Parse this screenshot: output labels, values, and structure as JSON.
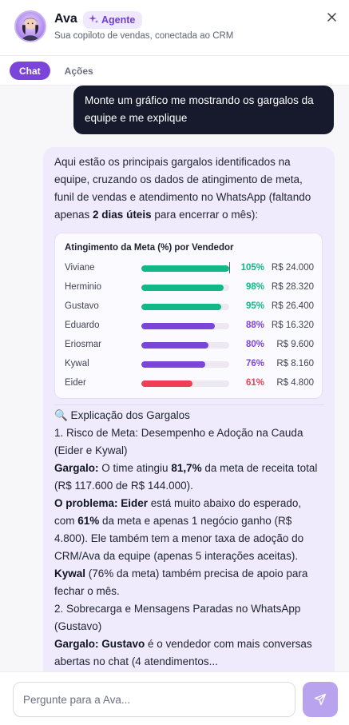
{
  "header": {
    "name": "Ava",
    "badge": "Agente",
    "subtitle": "Sua copiloto de vendas, conectada ao CRM"
  },
  "tabs": [
    {
      "label": "Chat",
      "active": true
    },
    {
      "label": "Ações",
      "active": false
    }
  ],
  "user_message": "Monte um gráfico me mostrando os gargalos da equipe e me explique",
  "bot": {
    "intro_before": "Aqui estão os principais gargalos identificados na equipe, cruzando os dados de atingimento de meta, funil de vendas e atendimento no WhatsApp (faltando apenas ",
    "intro_bold": "2 dias úteis",
    "intro_after": " para encerrar o mês):",
    "chart_title": "Atingimento da Meta (%) por Vendedor",
    "explanation_heading": "🔍 Explicação dos Gargalos",
    "item1_title": "1. Risco de Meta: Desempenho e Adoção na Cauda (Eider e Kywal)",
    "item1_p1_label": "Gargalo:",
    "item1_p1_a": " O time atingiu ",
    "item1_p1_bold": "81,7%",
    "item1_p1_b": " da meta de receita total (R$ 117.600 de R$ 144.000).",
    "item1_p2_label": "O problema:",
    "item1_p2_name": " Eider",
    "item1_p2_a": " está muito abaixo do esperado, com ",
    "item1_p2_bold": "61%",
    "item1_p2_b": " da meta e apenas 1 negócio ganho (R$ 4.800). Ele também tem a menor taxa de adoção do CRM/Ava da equipe (apenas 5 interações aceitas).",
    "item1_p3_name": "Kywal",
    "item1_p3_rest": " (76% da meta) também precisa de apoio para fechar o mês.",
    "item2_title": "2. Sobrecarga e Mensagens Paradas no WhatsApp (Gustavo)",
    "item2_p1_label": "Gargalo:",
    "item2_p1_name": " Gustavo",
    "item2_p1_rest": " é o vendedor com mais conversas abertas no chat (4 atendimentos..."
  },
  "colors": {
    "green": "#12b886",
    "purple": "#7c45d9",
    "red": "#f03e56",
    "accent": "#7c45d9"
  },
  "chart_data": {
    "type": "bar",
    "title": "Atingimento da Meta (%) por Vendedor",
    "categories": [
      "Viviane",
      "Herminio",
      "Gustavo",
      "Eduardo",
      "Eriosmar",
      "Kywal",
      "Eider"
    ],
    "values": [
      105,
      98,
      95,
      88,
      80,
      76,
      61
    ],
    "value_labels": [
      "105%",
      "98%",
      "95%",
      "88%",
      "80%",
      "76%",
      "61%"
    ],
    "revenue_labels": [
      "R$ 24.000",
      "R$ 28.320",
      "R$ 26.400",
      "R$ 16.320",
      "R$ 9.600",
      "R$ 8.160",
      "R$ 4.800"
    ],
    "bar_colors": [
      "#12b886",
      "#12b886",
      "#12b886",
      "#7c45d9",
      "#7c45d9",
      "#7c45d9",
      "#f03e56"
    ],
    "xlim": [
      0,
      105
    ],
    "grid": false
  },
  "input": {
    "placeholder": "Pergunte para a Ava..."
  }
}
